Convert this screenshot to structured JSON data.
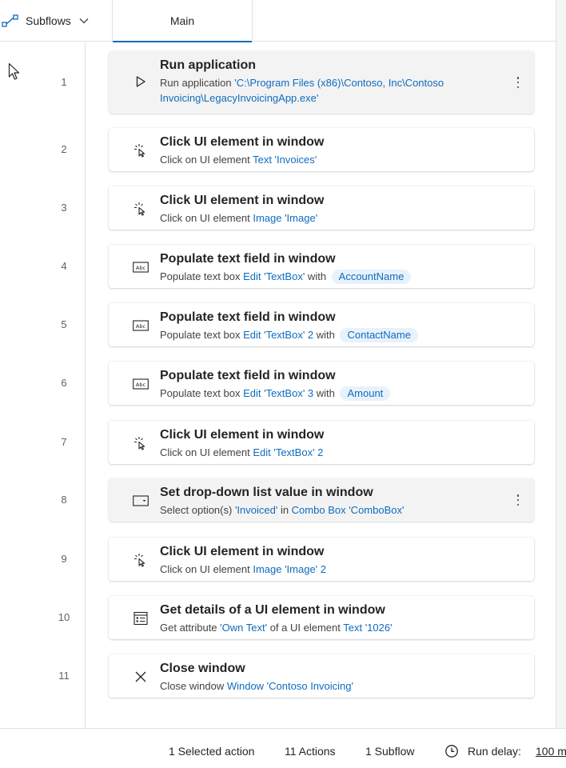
{
  "tabs": {
    "subflows_label": "Subflows",
    "main_label": "Main"
  },
  "actions": [
    {
      "line": "1",
      "icon": "play-icon",
      "title": "Run application",
      "desc": [
        {
          "t": "Run application "
        },
        {
          "t": "'C:\\Program Files (x86)\\Contoso, Inc\\Contoso Invoicing\\LegacyInvoicingApp.exe'",
          "k": "link"
        }
      ]
    },
    {
      "line": "2",
      "icon": "click-icon",
      "title": "Click UI element in window",
      "desc": [
        {
          "t": "Click on UI element "
        },
        {
          "t": "Text 'Invoices'",
          "k": "link"
        }
      ]
    },
    {
      "line": "3",
      "icon": "click-icon",
      "title": "Click UI element in window",
      "desc": [
        {
          "t": "Click on UI element "
        },
        {
          "t": "Image 'Image'",
          "k": "link"
        }
      ]
    },
    {
      "line": "4",
      "icon": "textbox-icon",
      "title": "Populate text field in window",
      "desc": [
        {
          "t": "Populate text box "
        },
        {
          "t": "Edit 'TextBox'",
          "k": "link"
        },
        {
          "t": " with "
        },
        {
          "t": "AccountName",
          "k": "pill"
        }
      ]
    },
    {
      "line": "5",
      "icon": "textbox-icon",
      "title": "Populate text field in window",
      "desc": [
        {
          "t": "Populate text box "
        },
        {
          "t": "Edit 'TextBox' 2",
          "k": "link"
        },
        {
          "t": " with "
        },
        {
          "t": "ContactName",
          "k": "pill"
        }
      ]
    },
    {
      "line": "6",
      "icon": "textbox-icon",
      "title": "Populate text field in window",
      "desc": [
        {
          "t": "Populate text box "
        },
        {
          "t": "Edit 'TextBox' 3",
          "k": "link"
        },
        {
          "t": " with "
        },
        {
          "t": "Amount",
          "k": "pill"
        }
      ]
    },
    {
      "line": "7",
      "icon": "click-icon",
      "title": "Click UI element in window",
      "desc": [
        {
          "t": "Click on UI element "
        },
        {
          "t": "Edit 'TextBox' 2",
          "k": "link"
        }
      ]
    },
    {
      "line": "8",
      "icon": "dropdown-icon",
      "title": "Set drop-down list value in window",
      "desc": [
        {
          "t": "Select option(s) "
        },
        {
          "t": "'Invoiced'",
          "k": "link"
        },
        {
          "t": " in "
        },
        {
          "t": "Combo Box 'ComboBox'",
          "k": "link"
        }
      ]
    },
    {
      "line": "9",
      "icon": "click-icon",
      "title": "Click UI element in window",
      "desc": [
        {
          "t": "Click on UI element "
        },
        {
          "t": "Image 'Image' 2",
          "k": "link"
        }
      ]
    },
    {
      "line": "10",
      "icon": "details-icon",
      "title": "Get details of a UI element in window",
      "desc": [
        {
          "t": "Get attribute "
        },
        {
          "t": "'Own Text'",
          "k": "link"
        },
        {
          "t": " of a UI element "
        },
        {
          "t": "Text '1026'",
          "k": "link"
        }
      ]
    },
    {
      "line": "11",
      "icon": "close-icon",
      "title": "Close window",
      "desc": [
        {
          "t": "Close window "
        },
        {
          "t": "Window 'Contoso Invoicing'",
          "k": "link"
        }
      ]
    }
  ],
  "status": {
    "selected": "1 Selected action",
    "actions_count": "11 Actions",
    "subflow_count": "1 Subflow",
    "run_delay_label": "Run delay:",
    "run_delay_value": "100 m"
  },
  "colors": {
    "accent": "#0f6cbd",
    "pill_bg": "#e8f2fc",
    "selected_card": "#f3f3f3"
  }
}
